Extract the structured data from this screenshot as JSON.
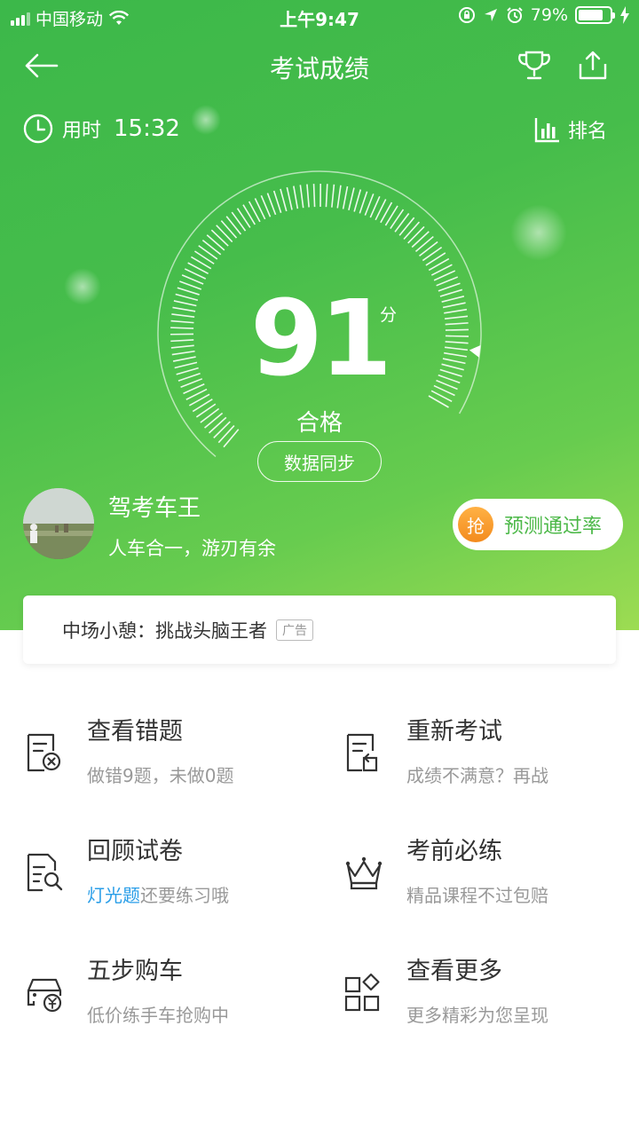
{
  "status_bar": {
    "carrier": "中国移动",
    "time": "上午9:47",
    "battery": "79%",
    "battery_level": 0.79
  },
  "nav": {
    "title": "考试成绩"
  },
  "timer": {
    "label": "用时",
    "value": "15:32"
  },
  "rank": {
    "label": "排名"
  },
  "score": {
    "value": "91",
    "unit": "分",
    "result": "合格",
    "max": 100,
    "sync_label": "数据同步"
  },
  "user": {
    "title": "驾考车王",
    "subtitle": "人车合一，游刃有余"
  },
  "predict": {
    "badge": "抢",
    "label": "预测通过率"
  },
  "ad": {
    "text": "中场小憩：挑战头脑王者",
    "tag": "广告"
  },
  "menu": [
    {
      "title": "查看错题",
      "sub": "做错9题，未做0题",
      "icon": "wrong-questions-icon"
    },
    {
      "title": "重新考试",
      "sub": "成绩不满意？再战",
      "icon": "retake-exam-icon"
    },
    {
      "title": "回顾试卷",
      "sub_highlight": "灯光题",
      "sub": "还要练习哦",
      "icon": "review-paper-icon"
    },
    {
      "title": "考前必练",
      "sub": "精品课程不过包赔",
      "icon": "crown-icon"
    },
    {
      "title": "五步购车",
      "sub": "低价练手车抢购中",
      "icon": "car-purchase-icon"
    },
    {
      "title": "查看更多",
      "sub": "更多精彩为您呈现",
      "icon": "more-grid-icon"
    }
  ],
  "colors": {
    "brand_green": "#46bd4b",
    "highlight_blue": "#2a9ee8",
    "badge_orange": "#f38b1e"
  }
}
